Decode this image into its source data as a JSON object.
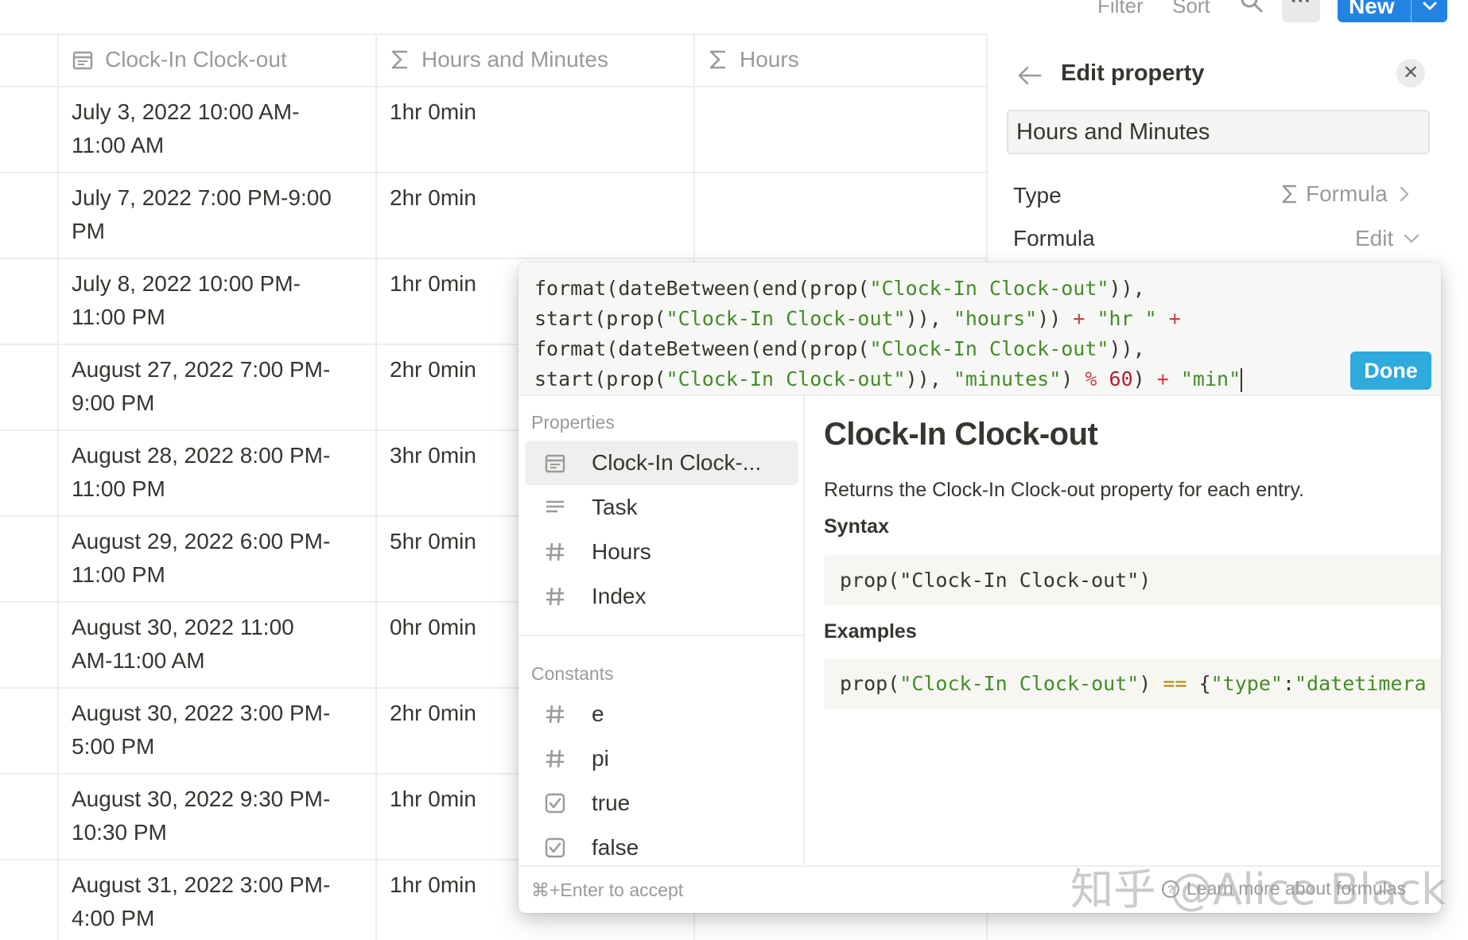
{
  "toolbar": {
    "filter_label": "Filter",
    "sort_label": "Sort",
    "more_label": "···",
    "new_label": "New"
  },
  "table": {
    "headers": [
      "Clock-In Clock-out",
      "Hours and Minutes",
      "Hours"
    ],
    "rows": [
      {
        "clock_line1": "July 3, 2022 10:00 AM-",
        "clock_line2": "11:00 AM",
        "hm": "1hr 0min"
      },
      {
        "clock_line1": "July 7, 2022 7:00 PM-9:00",
        "clock_line2": "PM",
        "hm": "2hr 0min"
      },
      {
        "clock_line1": "July 8, 2022 10:00 PM-",
        "clock_line2": "11:00 PM",
        "hm": "1hr 0min"
      },
      {
        "clock_line1": "August 27, 2022 7:00 PM-",
        "clock_line2": "9:00 PM",
        "hm": "2hr 0min"
      },
      {
        "clock_line1": "August 28, 2022 8:00 PM-",
        "clock_line2": "11:00 PM",
        "hm": "3hr 0min"
      },
      {
        "clock_line1": "August 29, 2022 6:00 PM-",
        "clock_line2": "11:00 PM",
        "hm": "5hr 0min"
      },
      {
        "clock_line1": "August 30, 2022 11:00",
        "clock_line2": "AM-11:00 AM",
        "hm": "0hr 0min"
      },
      {
        "clock_line1": "August 30, 2022 3:00 PM-",
        "clock_line2": "5:00 PM",
        "hm": "2hr 0min"
      },
      {
        "clock_line1": "August 30, 2022 9:30 PM-",
        "clock_line2": "10:30 PM",
        "hm": "1hr 0min"
      },
      {
        "clock_line1": "August 31, 2022 3:00 PM-",
        "clock_line2": "4:00 PM",
        "hm": "1hr 0min"
      }
    ]
  },
  "panel": {
    "title": "Edit property",
    "name_value": "Hours and Minutes",
    "type_label": "Type",
    "type_value": "Formula",
    "formula_label": "Formula",
    "formula_value": "Edit"
  },
  "editor": {
    "code": {
      "l1_a": "format(dateBetween(end(prop(",
      "l1_s": "\"Clock-In Clock-out\"",
      "l1_b": ")),",
      "l2_a": "start(prop(",
      "l2_s1": "\"Clock-In Clock-out\"",
      "l2_b": ")), ",
      "l2_s2": "\"hours\"",
      "l2_c": ")) ",
      "l2_op1": "+",
      "l2_s3": "\"hr \"",
      "l2_op2": "+",
      "l3_a": "format(dateBetween(end(prop(",
      "l3_s": "\"Clock-In Clock-out\"",
      "l3_b": ")),",
      "l4_a": "start(prop(",
      "l4_s1": "\"Clock-In Clock-out\"",
      "l4_b": ")), ",
      "l4_s2": "\"minutes\"",
      "l4_c": ") ",
      "l4_op1": "%",
      "l4_num": "60",
      "l4_d": ") ",
      "l4_op2": "+",
      "l4_s3": "\"min\""
    },
    "done_label": "Done",
    "properties_heading": "Properties",
    "properties": [
      {
        "label": "Clock-In Clock-...",
        "icon": "calendar-icon"
      },
      {
        "label": "Task",
        "icon": "text-lines-icon"
      },
      {
        "label": "Hours",
        "icon": "hash-icon"
      },
      {
        "label": "Index",
        "icon": "hash-icon"
      }
    ],
    "constants_heading": "Constants",
    "constants": [
      {
        "label": "e",
        "icon": "hash-icon"
      },
      {
        "label": "pi",
        "icon": "hash-icon"
      },
      {
        "label": "true",
        "icon": "checkbox-icon"
      },
      {
        "label": "false",
        "icon": "checkbox-icon"
      }
    ],
    "doc": {
      "title": "Clock-In Clock-out",
      "description": "Returns the Clock-In Clock-out property for each entry.",
      "syntax_heading": "Syntax",
      "syntax_a": "prop(\"Clock-In Clock-out\")",
      "examples_heading": "Examples",
      "example_a": "prop(",
      "example_s1": "\"Clock-In Clock-out\"",
      "example_b": ") ",
      "example_op": "==",
      "example_c": " {",
      "example_s2": "\"type\"",
      "example_d": ":",
      "example_s3": "\"datetimera"
    },
    "footer_hint": "⌘+Enter to accept",
    "footer_learn": "Learn more about formulas"
  },
  "watermark": "知乎 @Alice Black",
  "colors": {
    "accent_blue": "#2383e2",
    "done_blue": "#2eaadc",
    "string_green": "#448c27",
    "operator_red": "#d73a49"
  }
}
